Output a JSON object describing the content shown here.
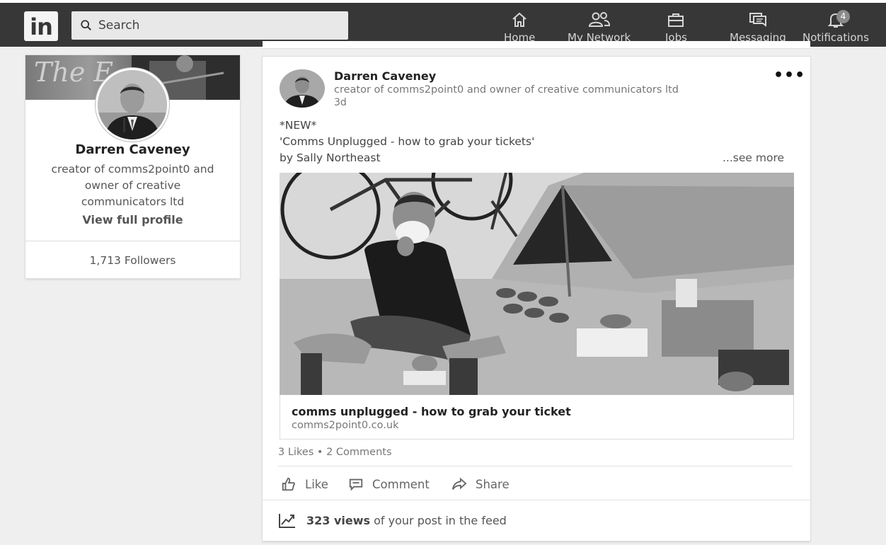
{
  "nav": {
    "search_placeholder": "Search",
    "items": [
      {
        "label": "Home",
        "icon": "home-icon"
      },
      {
        "label": "My Network",
        "icon": "network-icon"
      },
      {
        "label": "Jobs",
        "icon": "briefcase-icon"
      },
      {
        "label": "Messaging",
        "icon": "messaging-icon"
      },
      {
        "label": "Notifications",
        "icon": "bell-icon"
      }
    ],
    "notifications_badge": "4"
  },
  "profile": {
    "cover_text": "The E",
    "name": "Darren Caveney",
    "headline": "creator of comms2point0 and owner of creative communicators ltd",
    "view_profile": "View full profile",
    "followers": "1,713 Followers"
  },
  "post": {
    "author": "Darren Caveney",
    "author_headline": "creator of comms2point0 and owner of creative communicators ltd",
    "time": "3d",
    "more_label": "•••",
    "text_line1": "*NEW*",
    "text_line2": "'Comms Unplugged - how to grab your tickets'",
    "text_line3": "by Sally Northeast",
    "see_more": "...see more",
    "link_title": "comms unplugged - how to grab your ticket",
    "link_source": "comms2point0.co.uk",
    "counts": "3 Likes • 2 Comments",
    "actions": {
      "like": "Like",
      "comment": "Comment",
      "share": "Share"
    },
    "views_count": "323 views",
    "views_rest": " of your post in the feed"
  },
  "colors": {
    "topbar": "#373737",
    "page_bg": "#efefef",
    "card_bg": "#ffffff"
  }
}
